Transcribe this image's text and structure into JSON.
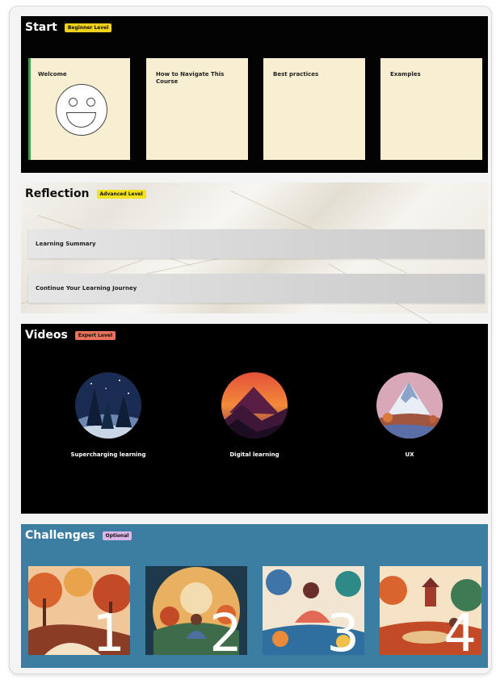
{
  "start": {
    "title": "Start",
    "badge": "Beginner Level",
    "badge_color": "#f2d21b",
    "cards": [
      {
        "label": "Welcome",
        "icon": "smiley-icon"
      },
      {
        "label": "How to Navigate This Course"
      },
      {
        "label": "Best practices"
      },
      {
        "label": "Examples"
      }
    ]
  },
  "reflection": {
    "title": "Reflection",
    "badge": "Advanced Level",
    "badge_color": "#f2e21b",
    "items": [
      {
        "label": "Learning Summary"
      },
      {
        "label": "Continue Your Learning Journey"
      }
    ]
  },
  "videos": {
    "title": "Videos",
    "badge": "Expert Level",
    "badge_color": "#e8735a",
    "items": [
      {
        "label": "Supercharging learning",
        "thumb": "night-forest-icon"
      },
      {
        "label": "Digital learning",
        "thumb": "sunset-mountain-icon"
      },
      {
        "label": "UX",
        "thumb": "snowy-peak-icon"
      }
    ]
  },
  "challenges": {
    "title": "Challenges",
    "badge": "Optional",
    "badge_color": "#d8b6e6",
    "tiles": [
      {
        "number": "1",
        "thumb": "autumn-forest-icon"
      },
      {
        "number": "2",
        "thumb": "reading-woman-icon"
      },
      {
        "number": "3",
        "thumb": "floral-woman-icon"
      },
      {
        "number": "4",
        "thumb": "pagoda-garden-icon"
      }
    ]
  }
}
